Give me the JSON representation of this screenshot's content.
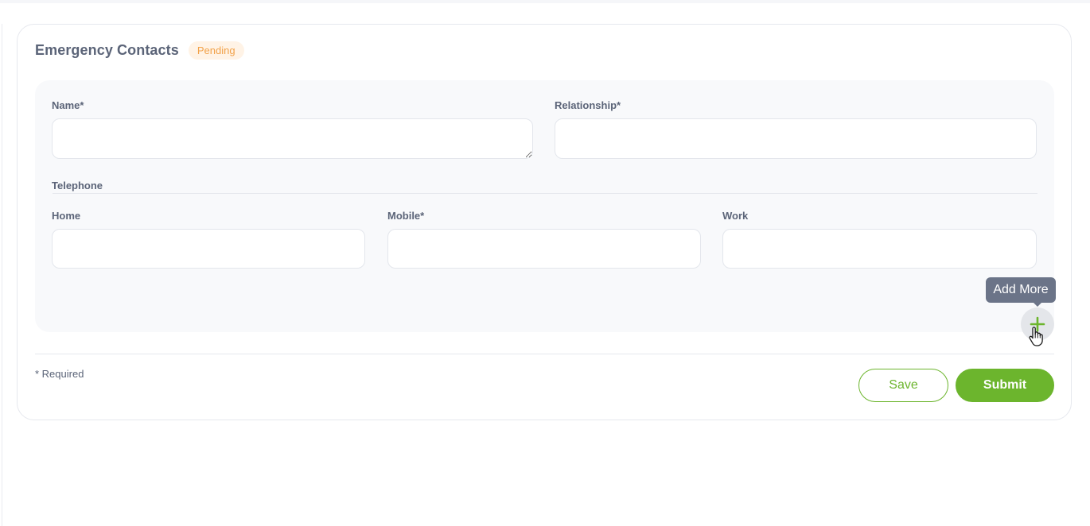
{
  "section": {
    "title": "Emergency Contacts",
    "status": "Pending"
  },
  "form": {
    "name_label": "Name*",
    "relationship_label": "Relationship*",
    "telephone_heading": "Telephone",
    "home_label": "Home",
    "mobile_label": "Mobile*",
    "work_label": "Work",
    "name_value": "",
    "relationship_value": "",
    "home_value": "",
    "mobile_value": "",
    "work_value": ""
  },
  "add_more": {
    "tooltip": "Add More",
    "icon": "plus-icon"
  },
  "footer": {
    "required_note": "* Required",
    "save_label": "Save",
    "submit_label": "Submit"
  },
  "colors": {
    "accent": "#6cb52d",
    "badge_text": "#f2a24a",
    "badge_bg": "#fff3e6",
    "tooltip_bg": "#6b7488"
  }
}
